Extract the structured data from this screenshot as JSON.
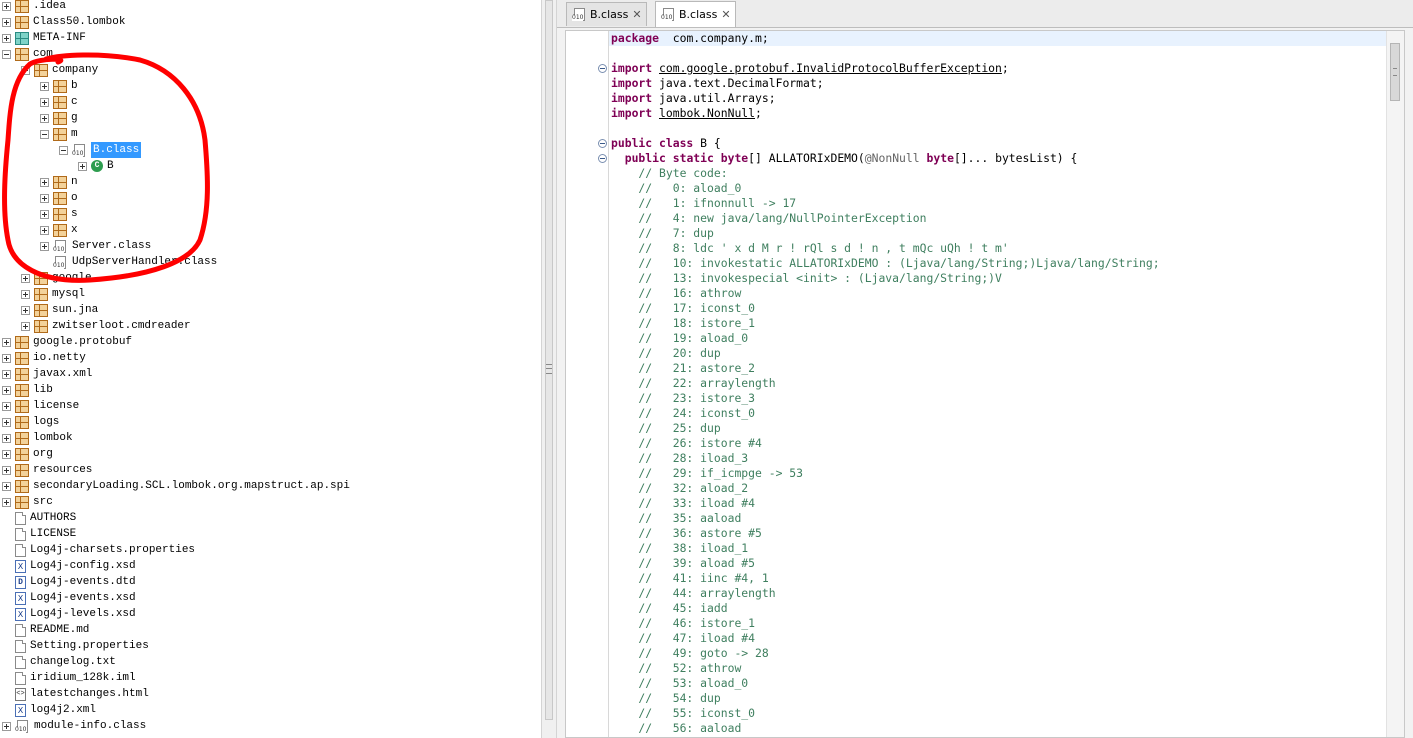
{
  "tree": {
    "items": [
      {
        "label": ".idea",
        "icon": "package-icon",
        "expander": "plus",
        "indent": 0
      },
      {
        "label": "Class50.lombok",
        "icon": "package-icon",
        "expander": "plus",
        "indent": 0
      },
      {
        "label": "META-INF",
        "icon": "package-teal-icon",
        "expander": "plus",
        "indent": 0
      },
      {
        "label": "com",
        "icon": "package-icon",
        "expander": "minus",
        "indent": 0
      },
      {
        "label": "company",
        "icon": "package-icon",
        "expander": "minus",
        "indent": 1
      },
      {
        "label": "b",
        "icon": "package-icon",
        "expander": "plus",
        "indent": 2
      },
      {
        "label": "c",
        "icon": "package-icon",
        "expander": "plus",
        "indent": 2
      },
      {
        "label": "g",
        "icon": "package-icon",
        "expander": "plus",
        "indent": 2
      },
      {
        "label": "m",
        "icon": "package-icon",
        "expander": "minus",
        "indent": 2
      },
      {
        "label": "B.class",
        "icon": "class-file-icon",
        "expander": "minus",
        "indent": 3,
        "selected": true
      },
      {
        "label": "B",
        "icon": "class-c-icon",
        "expander": "plus",
        "indent": 4
      },
      {
        "label": "n",
        "icon": "package-icon",
        "expander": "plus",
        "indent": 2
      },
      {
        "label": "o",
        "icon": "package-icon",
        "expander": "plus",
        "indent": 2
      },
      {
        "label": "s",
        "icon": "package-icon",
        "expander": "plus",
        "indent": 2
      },
      {
        "label": "x",
        "icon": "package-icon",
        "expander": "plus",
        "indent": 2
      },
      {
        "label": "Server.class",
        "icon": "class-file-icon",
        "expander": "plus",
        "indent": 2
      },
      {
        "label": "UdpServerHandler.class",
        "icon": "class-file-icon",
        "expander": "none",
        "indent": 2
      },
      {
        "label": "google",
        "icon": "package-icon",
        "expander": "plus",
        "indent": 1
      },
      {
        "label": "mysql",
        "icon": "package-icon",
        "expander": "plus",
        "indent": 1
      },
      {
        "label": "sun.jna",
        "icon": "package-icon",
        "expander": "plus",
        "indent": 1
      },
      {
        "label": "zwitserloot.cmdreader",
        "icon": "package-icon",
        "expander": "plus",
        "indent": 1
      },
      {
        "label": "google.protobuf",
        "icon": "package-icon",
        "expander": "plus",
        "indent": 0
      },
      {
        "label": "io.netty",
        "icon": "package-icon",
        "expander": "plus",
        "indent": 0
      },
      {
        "label": "javax.xml",
        "icon": "package-icon",
        "expander": "plus",
        "indent": 0
      },
      {
        "label": "lib",
        "icon": "package-icon",
        "expander": "plus",
        "indent": 0
      },
      {
        "label": "license",
        "icon": "package-icon",
        "expander": "plus",
        "indent": 0
      },
      {
        "label": "logs",
        "icon": "package-icon",
        "expander": "plus",
        "indent": 0
      },
      {
        "label": "lombok",
        "icon": "package-icon",
        "expander": "plus",
        "indent": 0
      },
      {
        "label": "org",
        "icon": "package-icon",
        "expander": "plus",
        "indent": 0
      },
      {
        "label": "resources",
        "icon": "package-icon",
        "expander": "plus",
        "indent": 0
      },
      {
        "label": "secondaryLoading.SCL.lombok.org.mapstruct.ap.spi",
        "icon": "package-icon",
        "expander": "plus",
        "indent": 0
      },
      {
        "label": "src",
        "icon": "package-icon",
        "expander": "plus",
        "indent": 0
      },
      {
        "label": "AUTHORS",
        "icon": "text-file-icon",
        "expander": "none",
        "indent": 0
      },
      {
        "label": "LICENSE",
        "icon": "text-file-icon",
        "expander": "none",
        "indent": 0
      },
      {
        "label": "Log4j-charsets.properties",
        "icon": "text-file-icon",
        "expander": "none",
        "indent": 0
      },
      {
        "label": "Log4j-config.xsd",
        "icon": "xml-file-icon",
        "expander": "none",
        "indent": 0
      },
      {
        "label": "Log4j-events.dtd",
        "icon": "dtd-file-icon",
        "expander": "none",
        "indent": 0
      },
      {
        "label": "Log4j-events.xsd",
        "icon": "xml-file-icon",
        "expander": "none",
        "indent": 0
      },
      {
        "label": "Log4j-levels.xsd",
        "icon": "xml-file-icon",
        "expander": "none",
        "indent": 0
      },
      {
        "label": "README.md",
        "icon": "text-file-icon",
        "expander": "none",
        "indent": 0
      },
      {
        "label": "Setting.properties",
        "icon": "text-file-icon",
        "expander": "none",
        "indent": 0
      },
      {
        "label": "changelog.txt",
        "icon": "text-file-icon",
        "expander": "none",
        "indent": 0
      },
      {
        "label": "iridium_128k.iml",
        "icon": "text-file-icon",
        "expander": "none",
        "indent": 0
      },
      {
        "label": "latestchanges.html",
        "icon": "html-file-icon",
        "expander": "none",
        "indent": 0
      },
      {
        "label": "log4j2.xml",
        "icon": "xml-file-icon",
        "expander": "none",
        "indent": 0
      },
      {
        "label": "module-info.class",
        "icon": "class-file-icon",
        "expander": "plus",
        "indent": 0
      }
    ]
  },
  "tabs": [
    {
      "label": "B.class",
      "icon": "class-file-icon",
      "close": "✕",
      "active": false
    },
    {
      "label": "B.class",
      "icon": "class-file-icon",
      "close": "✕",
      "active": true
    }
  ],
  "code": {
    "lines": [
      [
        [
          "kw",
          "package"
        ],
        [
          "",
          "  com.company.m;"
        ]
      ],
      [],
      [
        [
          "kw",
          "import"
        ],
        [
          "",
          " "
        ],
        [
          "ul",
          "com.google.protobuf.InvalidProtocolBufferException"
        ],
        [
          "",
          ";"
        ]
      ],
      [
        [
          "kw",
          "import"
        ],
        [
          "",
          " java.text.DecimalFormat;"
        ]
      ],
      [
        [
          "kw",
          "import"
        ],
        [
          "",
          " java.util.Arrays;"
        ]
      ],
      [
        [
          "kw",
          "import"
        ],
        [
          "",
          " "
        ],
        [
          "ul",
          "lombok.NonNull"
        ],
        [
          "",
          ";"
        ]
      ],
      [],
      [
        [
          "kw",
          "public class"
        ],
        [
          "",
          " B {"
        ]
      ],
      [
        [
          "",
          "  "
        ],
        [
          "kw",
          "public static byte"
        ],
        [
          "",
          "[] ALLATORIxDEMO("
        ],
        [
          "an",
          "@NonNull"
        ],
        [
          "",
          " "
        ],
        [
          "kw",
          "byte"
        ],
        [
          "",
          "[]... bytesList) {"
        ]
      ],
      [
        [
          "cm",
          "    // Byte code:"
        ]
      ],
      [
        [
          "cm",
          "    //   0: aload_0"
        ]
      ],
      [
        [
          "cm",
          "    //   1: ifnonnull -> 17"
        ]
      ],
      [
        [
          "cm",
          "    //   4: new java/lang/NullPointerException"
        ]
      ],
      [
        [
          "cm",
          "    //   7: dup"
        ]
      ],
      [
        [
          "cm",
          "    //   8: ldc ' x d M r ! rQl s d ! n , t mQc uQh ! t m'"
        ]
      ],
      [
        [
          "cm",
          "    //   10: invokestatic ALLATORIxDEMO : (Ljava/lang/String;)Ljava/lang/String;"
        ]
      ],
      [
        [
          "cm",
          "    //   13: invokespecial <init> : (Ljava/lang/String;)V"
        ]
      ],
      [
        [
          "cm",
          "    //   16: athrow"
        ]
      ],
      [
        [
          "cm",
          "    //   17: iconst_0"
        ]
      ],
      [
        [
          "cm",
          "    //   18: istore_1"
        ]
      ],
      [
        [
          "cm",
          "    //   19: aload_0"
        ]
      ],
      [
        [
          "cm",
          "    //   20: dup"
        ]
      ],
      [
        [
          "cm",
          "    //   21: astore_2"
        ]
      ],
      [
        [
          "cm",
          "    //   22: arraylength"
        ]
      ],
      [
        [
          "cm",
          "    //   23: istore_3"
        ]
      ],
      [
        [
          "cm",
          "    //   24: iconst_0"
        ]
      ],
      [
        [
          "cm",
          "    //   25: dup"
        ]
      ],
      [
        [
          "cm",
          "    //   26: istore #4"
        ]
      ],
      [
        [
          "cm",
          "    //   28: iload_3"
        ]
      ],
      [
        [
          "cm",
          "    //   29: if_icmpge -> 53"
        ]
      ],
      [
        [
          "cm",
          "    //   32: aload_2"
        ]
      ],
      [
        [
          "cm",
          "    //   33: iload #4"
        ]
      ],
      [
        [
          "cm",
          "    //   35: aaload"
        ]
      ],
      [
        [
          "cm",
          "    //   36: astore #5"
        ]
      ],
      [
        [
          "cm",
          "    //   38: iload_1"
        ]
      ],
      [
        [
          "cm",
          "    //   39: aload #5"
        ]
      ],
      [
        [
          "cm",
          "    //   41: iinc #4, 1"
        ]
      ],
      [
        [
          "cm",
          "    //   44: arraylength"
        ]
      ],
      [
        [
          "cm",
          "    //   45: iadd"
        ]
      ],
      [
        [
          "cm",
          "    //   46: istore_1"
        ]
      ],
      [
        [
          "cm",
          "    //   47: iload #4"
        ]
      ],
      [
        [
          "cm",
          "    //   49: goto -> 28"
        ]
      ],
      [
        [
          "cm",
          "    //   52: athrow"
        ]
      ],
      [
        [
          "cm",
          "    //   53: aload_0"
        ]
      ],
      [
        [
          "cm",
          "    //   54: dup"
        ]
      ],
      [
        [
          "cm",
          "    //   55: iconst_0"
        ]
      ],
      [
        [
          "cm",
          "    //   56: aaload"
        ]
      ]
    ],
    "fold_markers_at": [
      2,
      7,
      8
    ]
  },
  "colors": {
    "keyword": "#7f0055",
    "comment": "#3f7f5f",
    "selection": "#3399ff",
    "annotation_scribble": "#ff0000"
  }
}
